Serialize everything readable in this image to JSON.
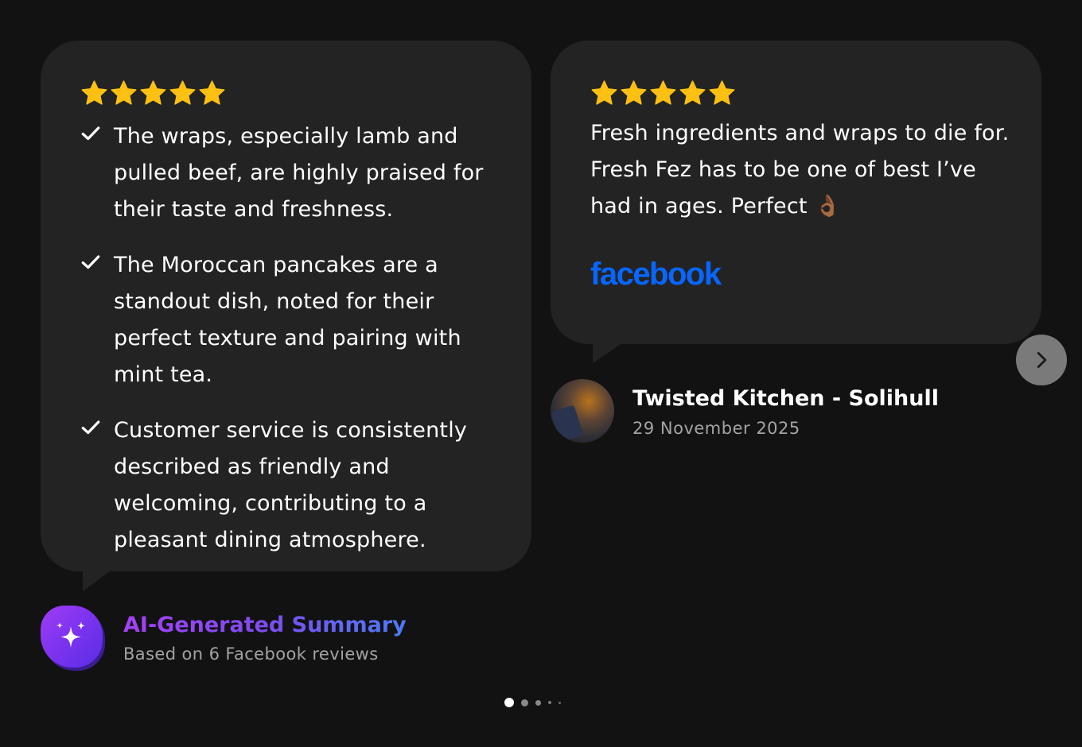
{
  "colors": {
    "page_background": "#121212",
    "card_background": "#232323",
    "star": "#fcc013",
    "facebook_blue": "#0866ff",
    "muted_text": "#a3a3a3",
    "ai_gradient_start": "#a540f5",
    "ai_gradient_end": "#4b7bf5"
  },
  "summary_card": {
    "rating": 5,
    "icons": {
      "star": "star-icon",
      "bullet": "checkmark-icon"
    },
    "points": [
      {
        "text": "The wraps, especially lamb and pulled beef, are highly praised for their taste and freshness."
      },
      {
        "text": "The Moroccan pancakes are a standout dish, noted for their perfect texture and pairing with mint tea."
      },
      {
        "text": "Customer service is consistently described as friendly and welcoming, contributing to a pleasant dining atmosphere."
      }
    ]
  },
  "ai_summary": {
    "icon": "sparkles-icon",
    "title": "AI-Generated Summary",
    "subtitle": "Based on 6 Facebook reviews"
  },
  "review_card": {
    "rating": 5,
    "text": "Fresh ingredients and wraps to die for. Fresh Fez has to be one of best I’ve had in ages. Perfect 👌🏾",
    "source": "facebook",
    "reviewer": {
      "name": "Twisted Kitchen - Solihull",
      "date": "29 November 2025",
      "avatar_icon": "avatar"
    }
  },
  "carousel": {
    "next_icon": "chevron-right-icon",
    "page_count": 5,
    "active_page": 1
  }
}
